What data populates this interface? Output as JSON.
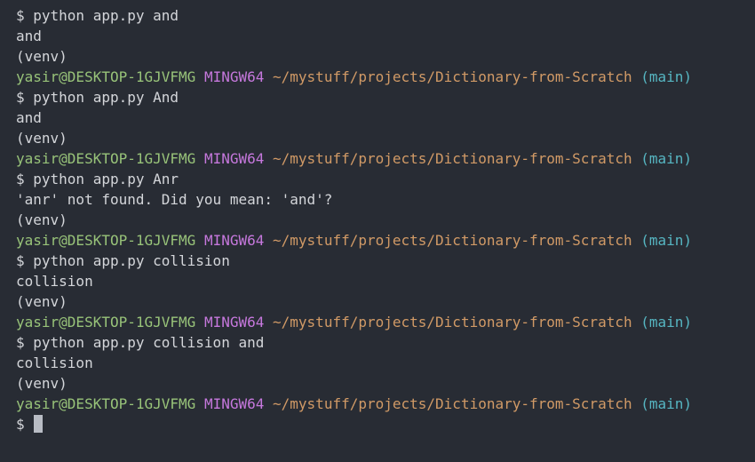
{
  "terminal": {
    "colors": {
      "background": "#282c34",
      "text": "#d4d6da",
      "user": "#98c379",
      "system": "#c678dd",
      "path": "#d19a66",
      "branch": "#56b6c2"
    },
    "prompt": {
      "user_host": "yasir@DESKTOP-1GJVFMG",
      "system": "MINGW64",
      "path": "~/mystuff/projects/Dictionary-from-Scratch",
      "branch": "(main)"
    },
    "lines": [
      "$ python app.py and",
      "and",
      "(venv)",
      "$ python app.py And",
      "and",
      "(venv)",
      "$ python app.py Anr",
      "'anr' not found. Did you mean: 'and'?",
      "(venv)",
      "$ python app.py collision",
      "collision",
      "(venv)",
      "$ python app.py collision and",
      "collision",
      "(venv)",
      "$"
    ]
  }
}
